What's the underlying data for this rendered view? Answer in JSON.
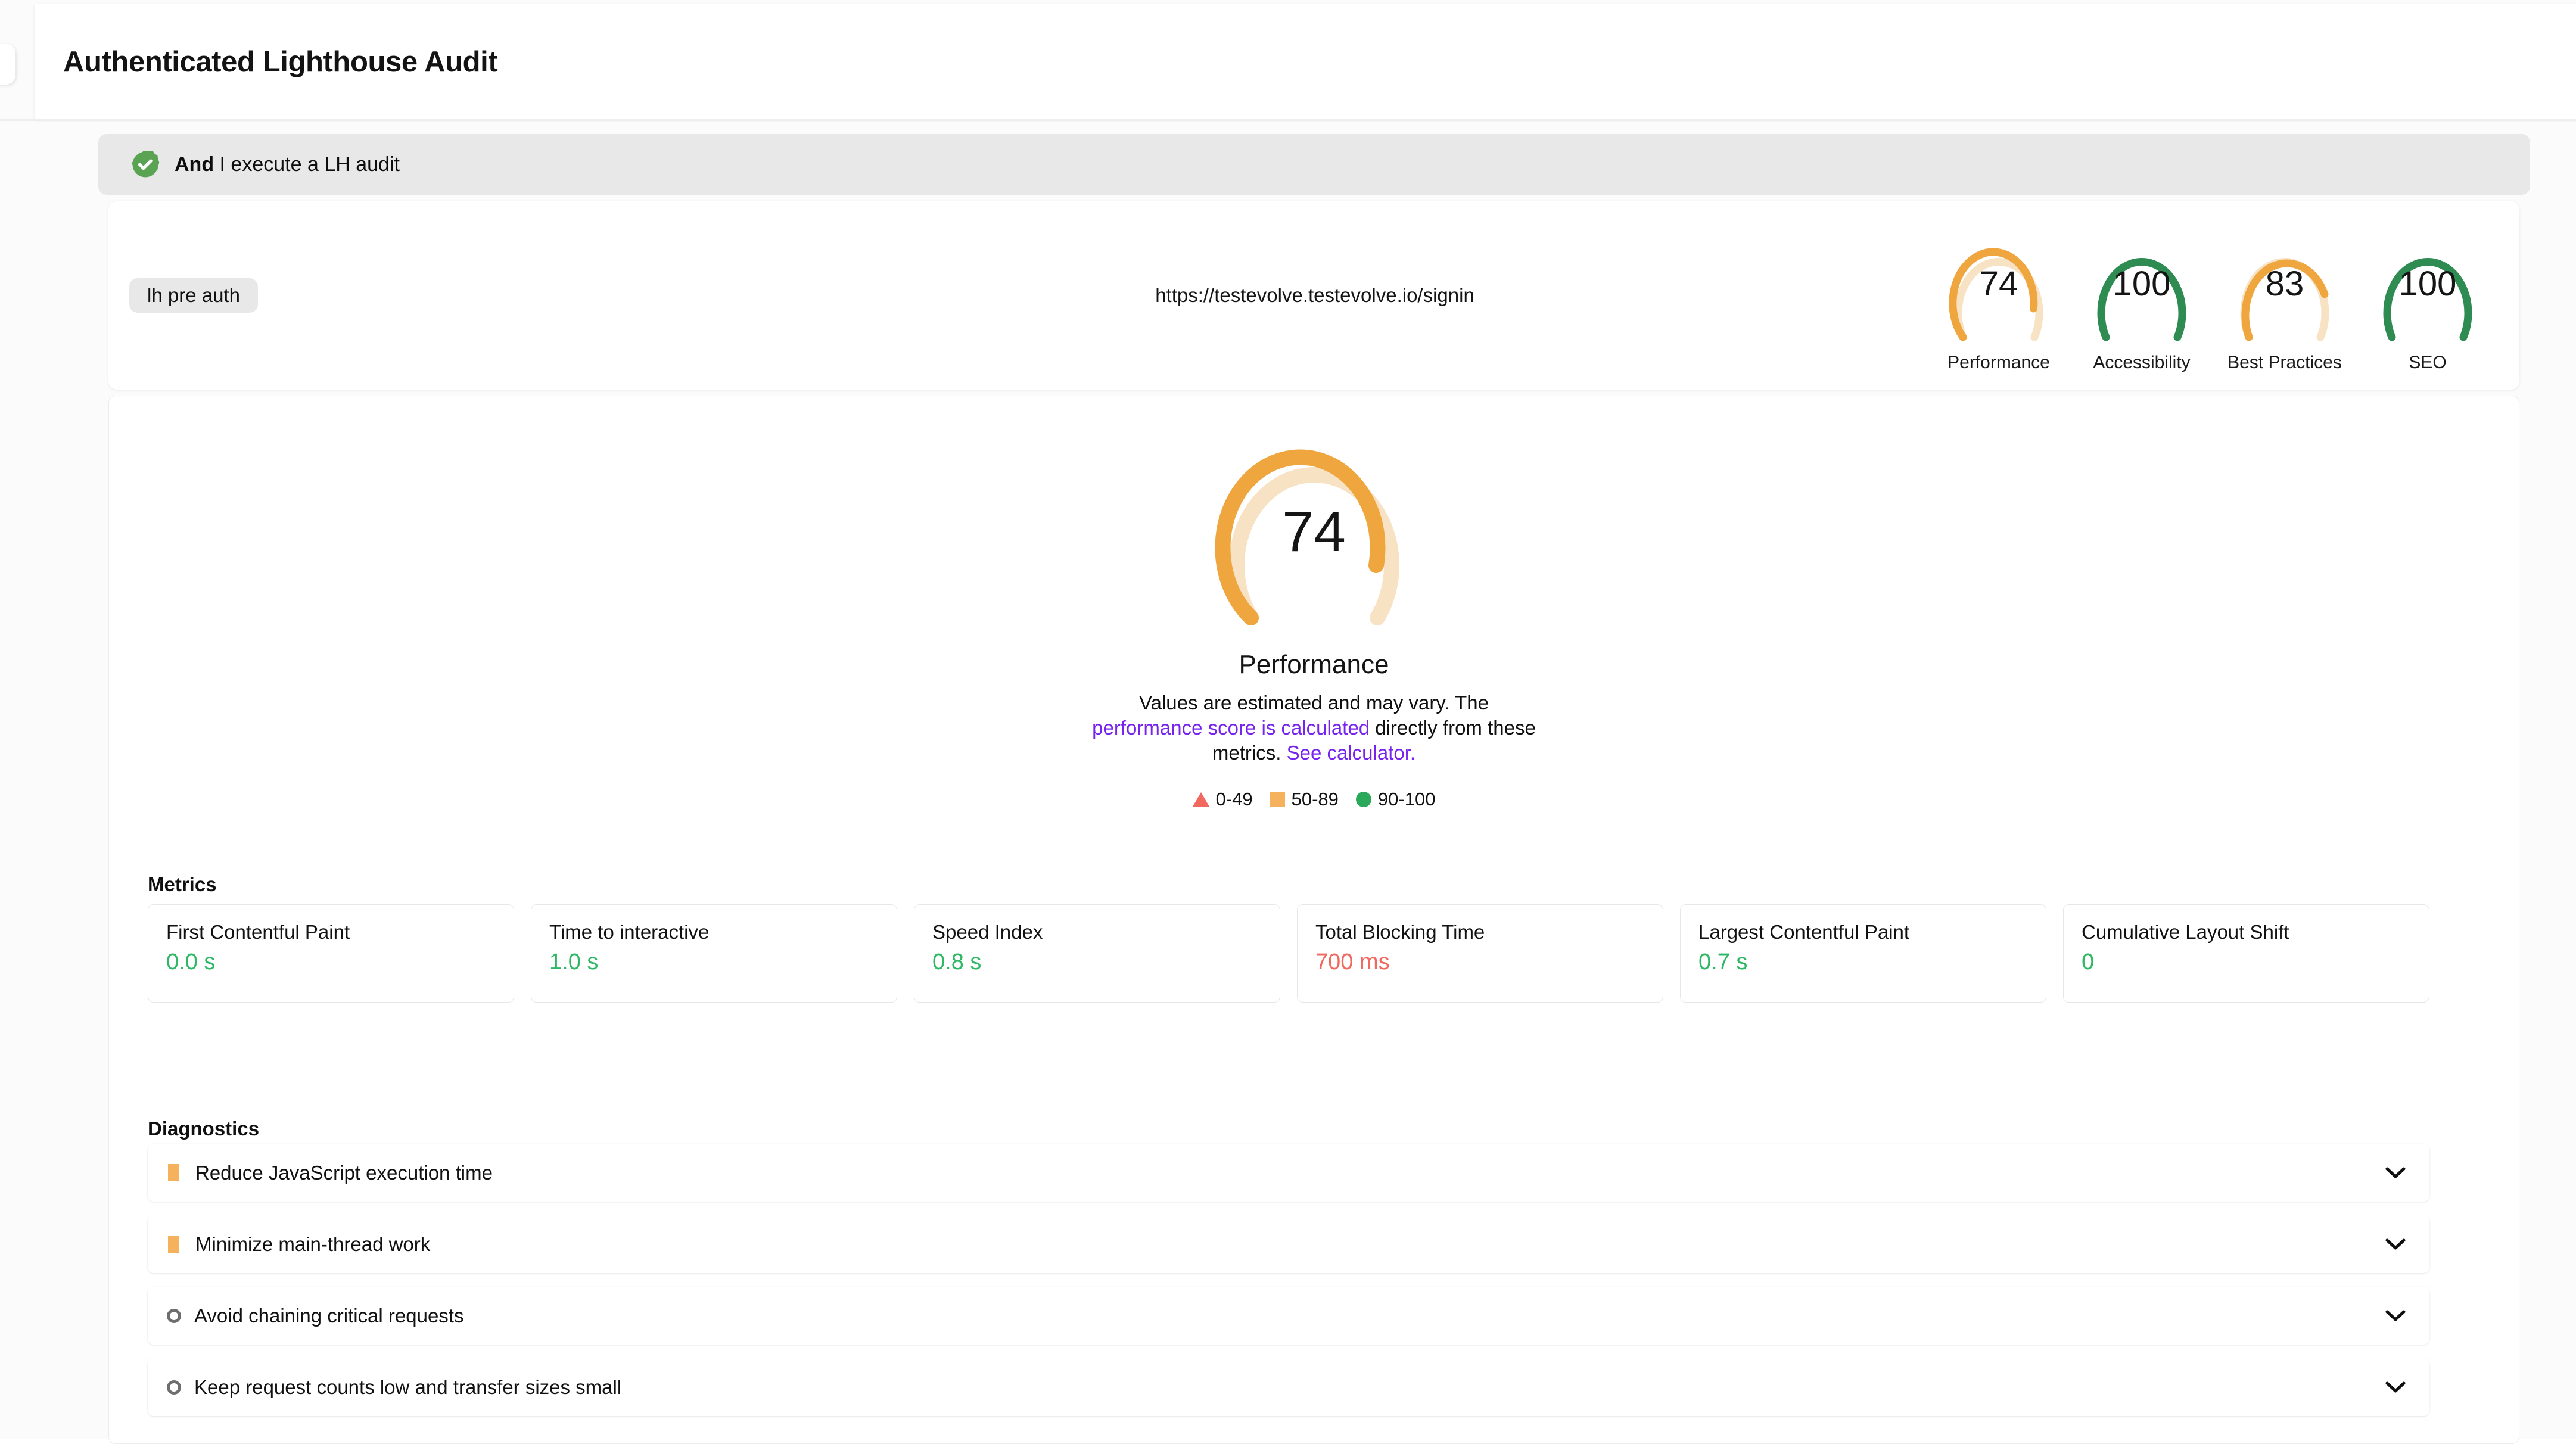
{
  "header": {
    "title": "Authenticated Lighthouse Audit"
  },
  "step": {
    "keyword": "And",
    "text": " I execute a LH audit",
    "status_icon": "check-badge-icon"
  },
  "summary": {
    "chip_label": "lh pre auth",
    "url": "https://testevolve.testevolve.io/signin",
    "gauges": [
      {
        "score": "74",
        "label": "Performance",
        "color": "#efa63f",
        "track": "#f7e3c4"
      },
      {
        "score": "100",
        "label": "Accessibility",
        "color": "#2e8b52",
        "track": "#2e8b52"
      },
      {
        "score": "83",
        "label": "Best Practices",
        "color": "#efa63f",
        "track": "#f7e3c4"
      },
      {
        "score": "100",
        "label": "SEO",
        "color": "#2e8b52",
        "track": "#2e8b52"
      }
    ]
  },
  "report": {
    "big_gauge": {
      "score": "74",
      "label": "Performance",
      "color": "#efa63f",
      "track": "#f7e3c4",
      "desc_part1": "Values are estimated and may vary. The ",
      "desc_link1": "performance score is calculated",
      "desc_part2": " directly from these metrics. ",
      "desc_link2": "See calculator.",
      "link_color": "#7722ee"
    },
    "legend": [
      {
        "shape": "triangle",
        "range": "0-49",
        "color": "#f1685e"
      },
      {
        "shape": "square",
        "range": "50-89",
        "color": "#f5b15c"
      },
      {
        "shape": "circle",
        "range": "90-100",
        "color": "#2ba95b"
      }
    ],
    "metrics_title": "Metrics",
    "metrics": [
      {
        "name": "First Contentful Paint",
        "value": "0.0 s",
        "value_class": "v-green"
      },
      {
        "name": "Time to interactive",
        "value": "1.0 s",
        "value_class": "v-green"
      },
      {
        "name": "Speed Index",
        "value": "0.8 s",
        "value_class": "v-green"
      },
      {
        "name": "Total Blocking Time",
        "value": "700 ms",
        "value_class": "v-red"
      },
      {
        "name": "Largest Contentful Paint",
        "value": "0.7 s",
        "value_class": "v-green"
      },
      {
        "name": "Cumulative Layout Shift",
        "value": "0",
        "value_class": "v-green"
      }
    ],
    "diagnostics_title": "Diagnostics",
    "diagnostics": [
      {
        "label": "Reduce JavaScript execution time",
        "icon": "square",
        "icon_color": "#f5b15c",
        "expand_icon": "chevron-down-icon"
      },
      {
        "label": "Minimize main-thread work",
        "icon": "square",
        "icon_color": "#f5b15c",
        "expand_icon": "chevron-down-icon"
      },
      {
        "label": "Avoid chaining critical requests",
        "icon": "circle",
        "icon_color": "#6e6e6e",
        "expand_icon": "chevron-down-icon"
      },
      {
        "label": "Keep request counts low and transfer sizes small",
        "icon": "circle",
        "icon_color": "#6e6e6e",
        "expand_icon": "chevron-down-icon"
      }
    ]
  }
}
